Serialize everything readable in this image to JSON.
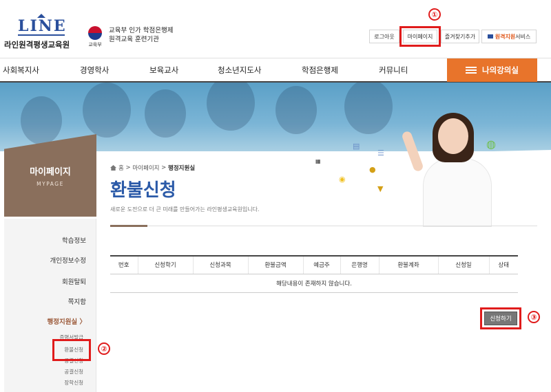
{
  "brand": {
    "logo_word": "LINE",
    "logo_name": "라인원격평생교육원",
    "ministry": "교육부",
    "gov_line1": "교육부 인가 학점은행제",
    "gov_line2": "원격교육 훈련기관"
  },
  "util": {
    "logout": "로그아웃",
    "mypage": "마이페이지",
    "favorite": "즐겨찾기추가",
    "remote_bold": "원격지원",
    "remote_rest": "서비스"
  },
  "gnb": {
    "items": [
      "사회복지사",
      "경영학사",
      "보육교사",
      "청소년지도사",
      "학점은행제",
      "커뮤니티"
    ],
    "myclass": "나의강의실"
  },
  "sidebar": {
    "title": "마이페이지",
    "subtitle": "MYPAGE",
    "items": [
      "학습정보",
      "개인정보수정",
      "회원탈퇴",
      "쪽지함",
      "행정지원실"
    ],
    "active_arrow": "〉",
    "sub_items": [
      "증명서발급",
      "환불신청",
      "공결신청",
      "공결신청",
      "장학신청"
    ]
  },
  "content": {
    "breadcrumb_home": "홈",
    "breadcrumb_sep": ">",
    "breadcrumb_mid": "마이페이지",
    "breadcrumb_current": "행정지원실",
    "title": "환불신청",
    "description": "새로운 도전으로 더 큰 미래를 만들어가는 라인평생교육원입니다."
  },
  "table": {
    "headers": [
      "번호",
      "신청학기",
      "신청과목",
      "환불금액",
      "예금주",
      "은행명",
      "환불계좌",
      "신청일",
      "상태"
    ],
    "empty_message": "해당내용이 존재하지 않습니다."
  },
  "apply_button": "신청하기",
  "annotations": [
    "①",
    "②",
    "③"
  ],
  "colors": {
    "accent_orange": "#e8742b",
    "title_blue": "#2b5aa8",
    "sidebar_brown": "#8a6f5c",
    "highlight_red": "#e01b1b"
  }
}
